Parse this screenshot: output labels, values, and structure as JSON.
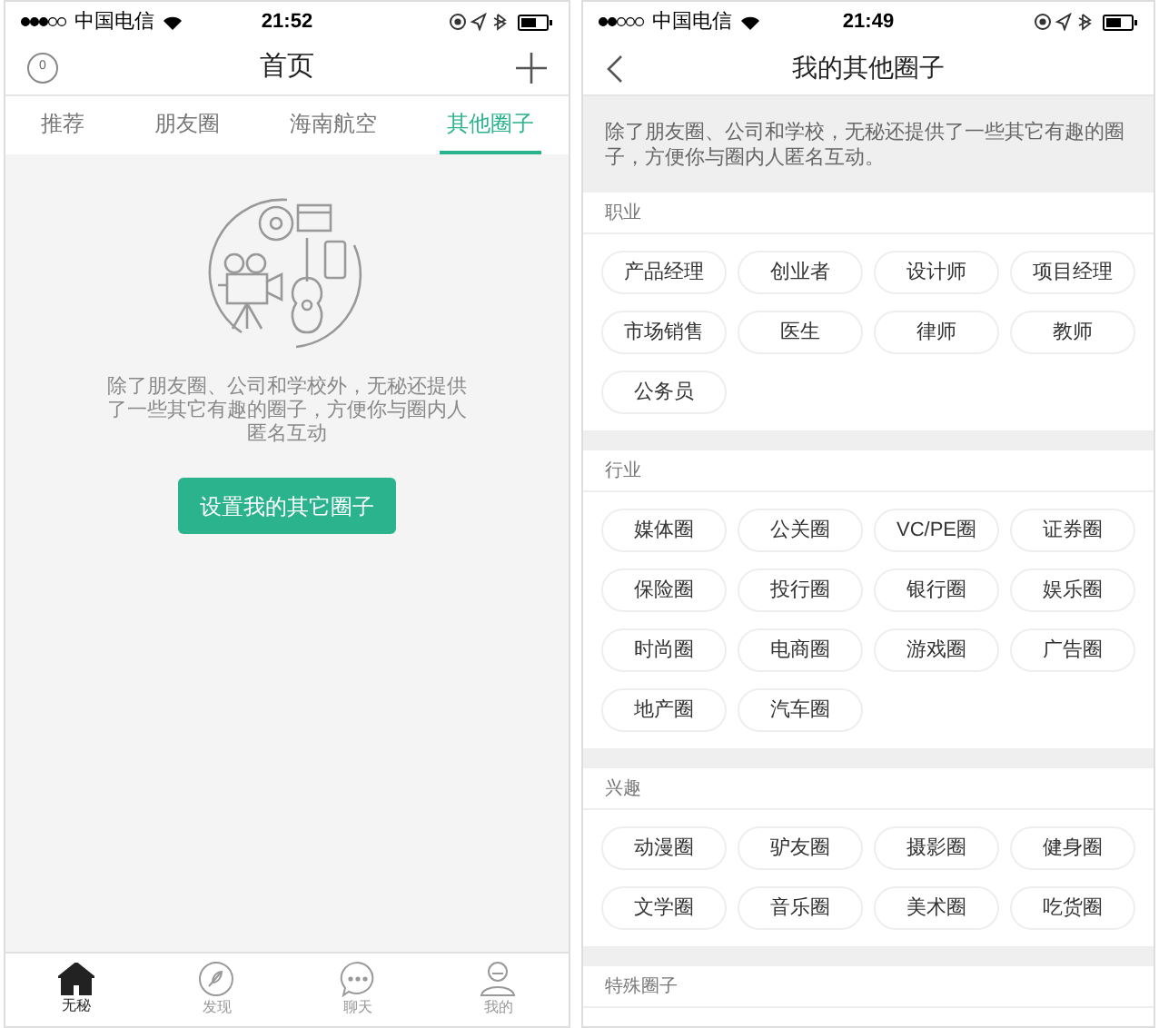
{
  "left_screen": {
    "status_bar": {
      "carrier": "中国电信",
      "time": "21:52"
    },
    "header": {
      "badge": "0",
      "title": "首页"
    },
    "tabs": [
      {
        "label": "推荐",
        "selected": false
      },
      {
        "label": "朋友圈",
        "selected": false
      },
      {
        "label": "海南航空",
        "selected": false
      },
      {
        "label": "其他圈子",
        "selected": true
      }
    ],
    "empty_state": {
      "message": "除了朋友圈、公司和学校外，无秘还提供了一些其它有趣的圈子，方便你与圈内人匿名互动",
      "button": "设置我的其它圈子"
    },
    "bottom_tabs": [
      {
        "kind": "home",
        "label": "无秘",
        "selected": true
      },
      {
        "kind": "discover",
        "label": "发现",
        "selected": false
      },
      {
        "kind": "chat",
        "label": "聊天",
        "selected": false
      },
      {
        "kind": "me",
        "label": "我的",
        "selected": false
      }
    ]
  },
  "right_screen": {
    "status_bar": {
      "carrier": "中国电信",
      "time": "21:49"
    },
    "header": {
      "title": "我的其他圈子"
    },
    "notice": "除了朋友圈、公司和学校，无秘还提供了一些其它有趣的圈子，方便你与圈内人匿名互动。",
    "sections": [
      {
        "title": "职业",
        "chips": [
          "产品经理",
          "创业者",
          "设计师",
          "项目经理",
          "市场销售",
          "医生",
          "律师",
          "教师",
          "公务员"
        ]
      },
      {
        "title": "行业",
        "chips": [
          "媒体圈",
          "公关圈",
          "VC/PE圈",
          "证券圈",
          "保险圈",
          "投行圈",
          "银行圈",
          "娱乐圈",
          "时尚圈",
          "电商圈",
          "游戏圈",
          "广告圈",
          "地产圈",
          "汽车圈"
        ]
      },
      {
        "title": "兴趣",
        "chips": [
          "动漫圈",
          "驴友圈",
          "摄影圈",
          "健身圈",
          "文学圈",
          "音乐圈",
          "美术圈",
          "吃货圈"
        ]
      },
      {
        "title": "特殊圈子"
      }
    ]
  }
}
